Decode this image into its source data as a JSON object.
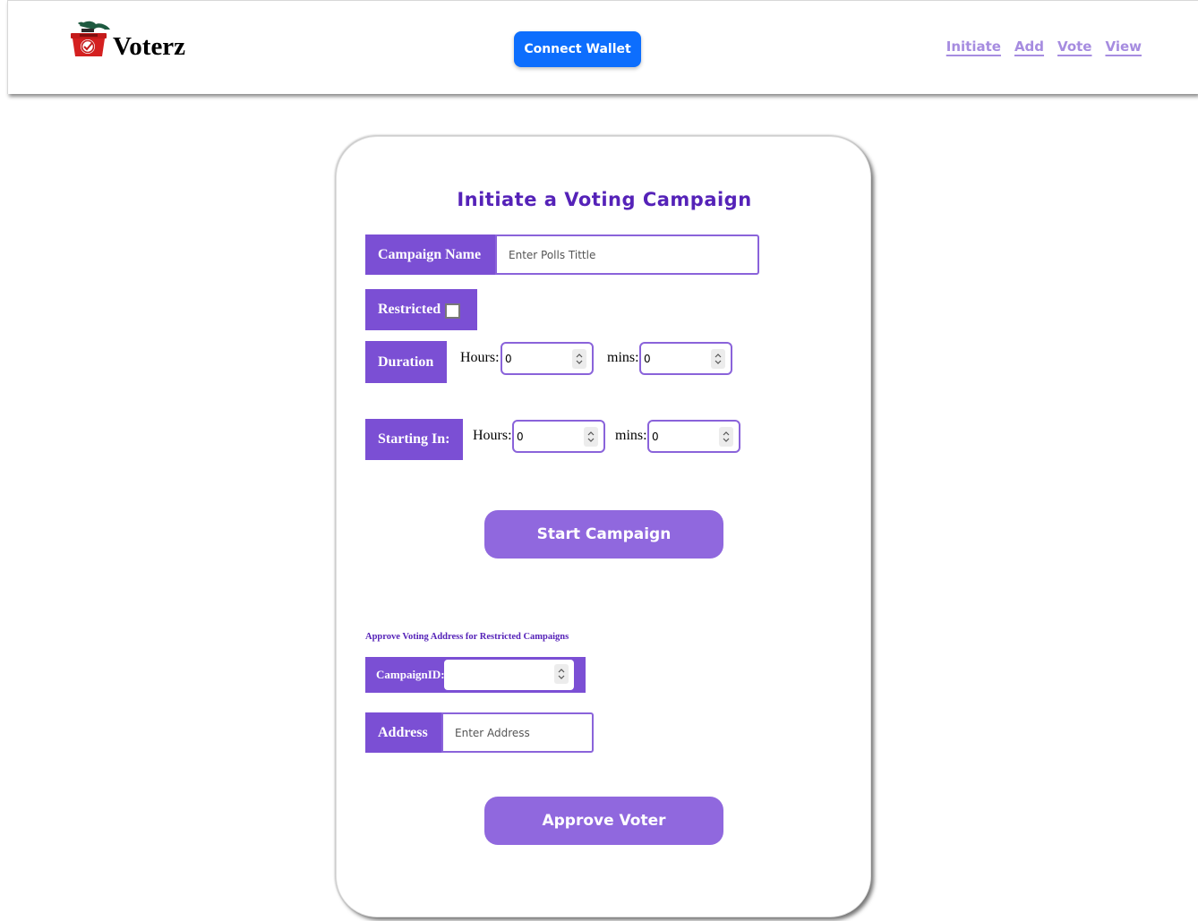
{
  "brand": {
    "name": "Voterz",
    "accent": "#7b4fd4",
    "title_color": "#5522b8",
    "logo_icon": "ballot-box-icon"
  },
  "header": {
    "connect_label": "Connect Wallet",
    "connect_color": "#0d6efd",
    "nav": [
      "Initiate",
      "Add",
      "Vote",
      "View"
    ]
  },
  "campaign_form": {
    "title": "Initiate a Voting Campaign",
    "campaign_name_label": "Campaign Name",
    "campaign_name_placeholder": "Enter Polls Tittle",
    "campaign_name_value": "",
    "restricted_label": "Restricted",
    "restricted_checked": false,
    "duration_label": "Duration",
    "duration_hours_caption": "Hours:",
    "duration_hours_value": "0",
    "duration_mins_caption": "mins:",
    "duration_mins_value": "0",
    "starting_label": "Starting In:",
    "starting_hours_caption": "Hours:",
    "starting_hours_value": "0",
    "starting_mins_caption": "mins:",
    "starting_mins_value": "0",
    "start_button": "Start Campaign"
  },
  "approve_form": {
    "caption": "Approve Voting Address for Restricted Campaigns",
    "campaign_id_label": "CampaignID:",
    "campaign_id_value": "",
    "address_label": "Address",
    "address_placeholder": "Enter Address",
    "approve_button": "Approve Voter"
  }
}
